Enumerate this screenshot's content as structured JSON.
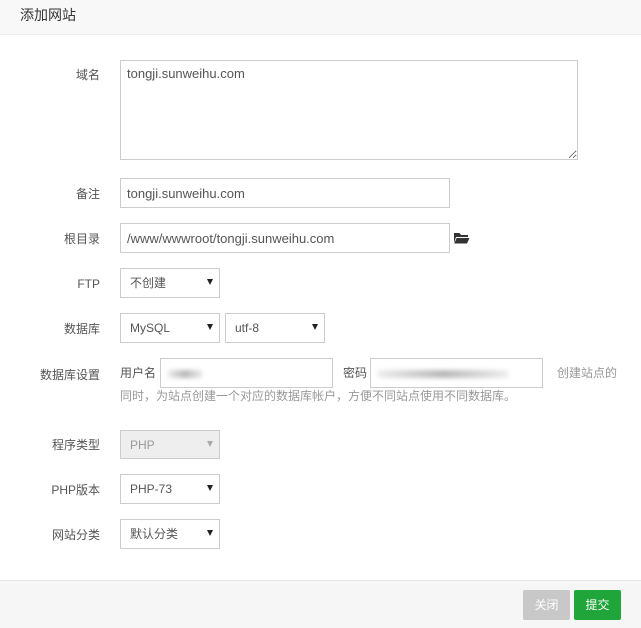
{
  "dialog": {
    "title": "添加网站"
  },
  "form": {
    "domain": {
      "label": "域名",
      "value": "tongji.sunweihu.com"
    },
    "remark": {
      "label": "备注",
      "value": "tongji.sunweihu.com"
    },
    "root_dir": {
      "label": "根目录",
      "value": "/www/wwwroot/tongji.sunweihu.com",
      "icon": "folder-open-icon"
    },
    "ftp": {
      "label": "FTP",
      "selected": "不创建"
    },
    "database": {
      "label": "数据库",
      "type_selected": "MySQL",
      "charset_selected": "utf-8"
    },
    "db_settings": {
      "label": "数据库设置",
      "username_label": "用户名",
      "password_label": "密码",
      "hint_line1": "创建站点的",
      "hint_line2": "同时，为站点创建一个对应的数据库帐户，方便不同站点使用不同数据库。"
    },
    "program_type": {
      "label": "程序类型",
      "selected": "PHP"
    },
    "php_version": {
      "label": "PHP版本",
      "selected": "PHP-73"
    },
    "site_category": {
      "label": "网站分类",
      "selected": "默认分类"
    }
  },
  "footer": {
    "close_label": "关闭",
    "submit_label": "提交"
  }
}
